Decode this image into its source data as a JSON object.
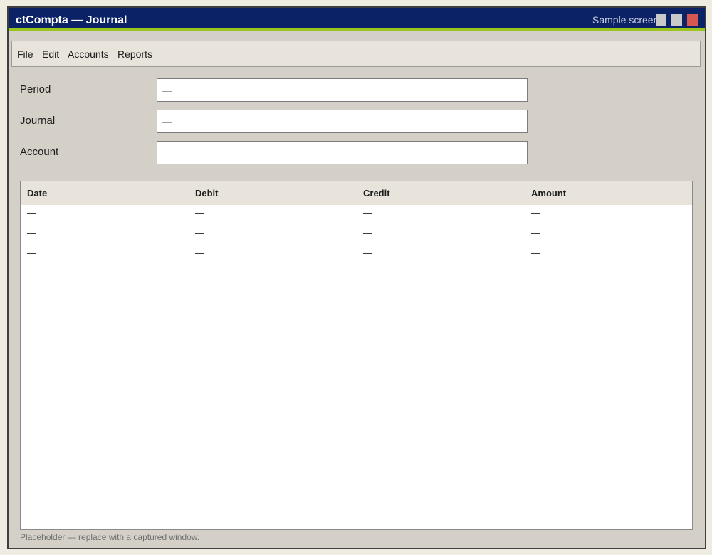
{
  "window": {
    "title": "ctCompta — Journal",
    "caption": "Sample screen"
  },
  "menu": {
    "items": [
      "File",
      "Edit",
      "Accounts",
      "Reports"
    ]
  },
  "form": {
    "fields": [
      {
        "label": "Period",
        "placeholder": "—"
      },
      {
        "label": "Journal",
        "placeholder": "—"
      },
      {
        "label": "Account",
        "placeholder": "—"
      }
    ]
  },
  "table": {
    "columns": [
      "Date",
      "Debit",
      "Credit",
      "Amount"
    ],
    "rows": [
      [
        "—",
        "—",
        "—",
        "—"
      ],
      [
        "—",
        "—",
        "—",
        "—"
      ],
      [
        "—",
        "—",
        "—",
        "—"
      ]
    ]
  },
  "footer": {
    "note": "Placeholder — replace with a captured window."
  },
  "colors": {
    "titlebar": "#0b2266",
    "accent_stripe": "#9ac51c",
    "window_background": "#d4d0c8",
    "close_button": "#d6574f"
  }
}
